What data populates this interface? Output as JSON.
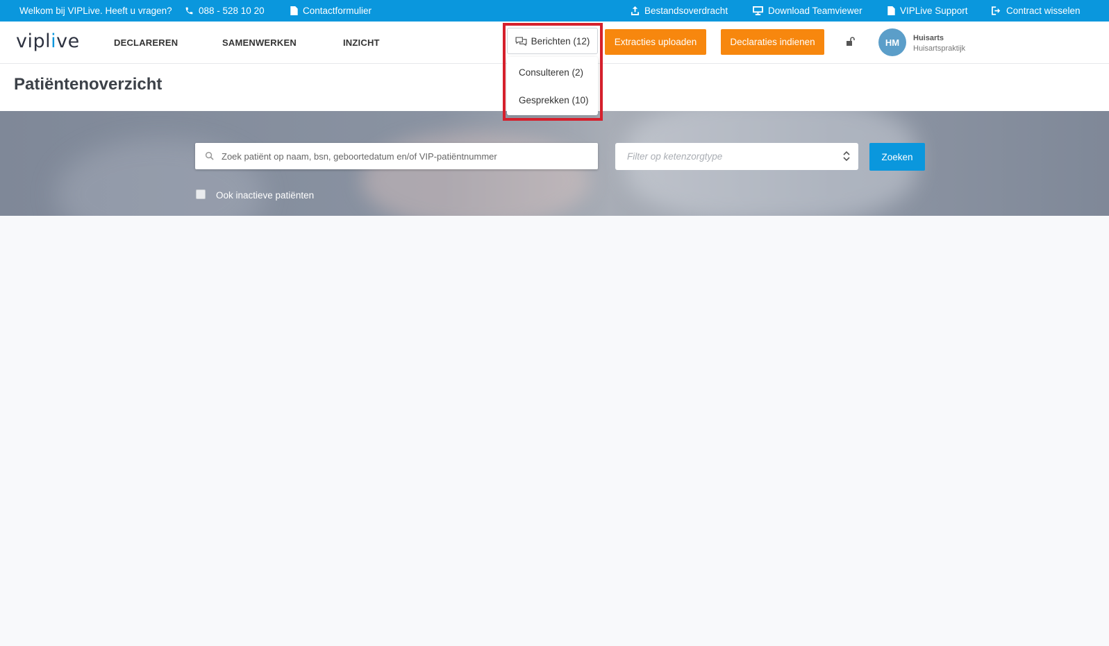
{
  "topbar": {
    "welcome": "Welkom bij VIPLive. Heeft u vragen?",
    "phone": "088 - 528 10 20",
    "contact": "Contactformulier",
    "bestandsoverdracht": "Bestandsoverdracht",
    "teamviewer": "Download Teamviewer",
    "support": "VIPLive Support",
    "contract": "Contract wisselen"
  },
  "header": {
    "logo_a": "vipl",
    "logo_b": "i",
    "logo_c": "ve",
    "nav": [
      "DECLAREREN",
      "SAMENWERKEN",
      "INZICHT"
    ],
    "messages_label": "Berichten (12)",
    "messages_menu": [
      "Consulteren (2)",
      "Gesprekken (10)"
    ],
    "extracties_label": "Extracties uploaden",
    "declaraties_label": "Declaraties indienen",
    "user": {
      "initials": "HM",
      "name": "Huisarts",
      "org": "Huisartspraktijk"
    }
  },
  "page": {
    "title": "Patiëntenoverzicht"
  },
  "search": {
    "placeholder": "Zoek patiënt op naam, bsn, geboortedatum en/of VIP-patiëntnummer",
    "filter_placeholder": "Filter op ketenzorgtype",
    "button": "Zoeken",
    "inactive_label": "Ook inactieve patiënten"
  },
  "colors": {
    "brand_blue": "#0a97dd",
    "orange": "#f7870e",
    "highlight_red": "#d5202c",
    "avatar": "#5b9ec9"
  },
  "icons": [
    "phone-icon",
    "document-icon",
    "upload-icon",
    "monitor-icon",
    "logout-icon",
    "chat-icon",
    "lock-icon",
    "search-icon",
    "sort-chevron-icon"
  ]
}
